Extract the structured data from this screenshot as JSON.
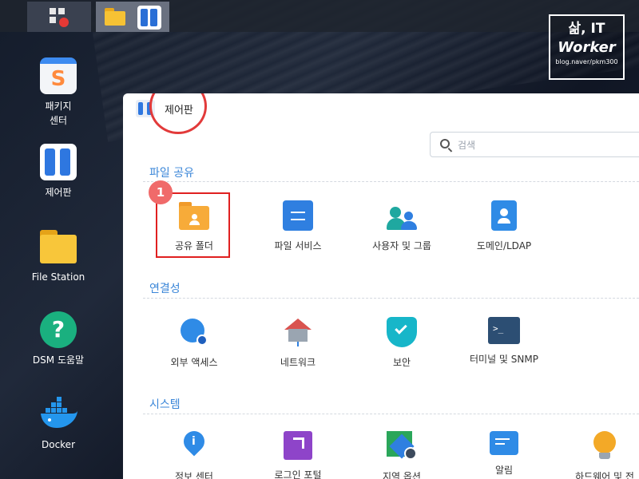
{
  "taskbar": {
    "main_menu_icon": "grid-icon",
    "apps": [
      {
        "name": "File Station",
        "icon": "folder-icon"
      },
      {
        "name": "제어판",
        "icon": "control-panel-icon"
      }
    ]
  },
  "desktop": {
    "items": [
      {
        "label_line1": "패키지",
        "label_line2": "센터",
        "icon": "package-center-icon"
      },
      {
        "label": "제어판",
        "icon": "control-panel-icon"
      },
      {
        "label": "File Station",
        "icon": "folder-icon"
      },
      {
        "label": "DSM 도움말",
        "icon": "help-icon"
      },
      {
        "label": "Docker",
        "icon": "docker-icon"
      }
    ]
  },
  "watermark": {
    "line1": "삶, IT",
    "line2": "Worker",
    "line3": "blog.naver/pkm300"
  },
  "window": {
    "title": "제어판",
    "search_placeholder": "검색",
    "annotation_number": "1",
    "sections": [
      {
        "title": "파일 공유",
        "items": [
          {
            "label": "공유 폴더",
            "icon": "shared-folder-icon"
          },
          {
            "label": "파일 서비스",
            "icon": "file-services-icon"
          },
          {
            "label": "사용자 및 그룹",
            "icon": "users-group-icon"
          },
          {
            "label": "도메인/LDAP",
            "icon": "domain-ldap-icon"
          }
        ]
      },
      {
        "title": "연결성",
        "items": [
          {
            "label": "외부 액세스",
            "icon": "external-access-icon"
          },
          {
            "label": "네트워크",
            "icon": "network-icon"
          },
          {
            "label": "보안",
            "icon": "security-shield-icon"
          },
          {
            "label": "터미널 및 SNMP",
            "icon": "terminal-icon"
          }
        ]
      },
      {
        "title": "시스템",
        "items": [
          {
            "label": "정보 센터",
            "icon": "info-center-icon"
          },
          {
            "label": "로그인 포털",
            "icon": "login-portal-icon"
          },
          {
            "label": "지역 옵션",
            "icon": "regional-options-icon"
          },
          {
            "label": "알림",
            "icon": "notification-icon"
          },
          {
            "label": "하드웨어 및 전",
            "icon": "hardware-power-icon"
          }
        ]
      }
    ]
  },
  "colors": {
    "accent": "#3a86d8",
    "highlight": "#e02020",
    "badge": "#f06a6a"
  }
}
